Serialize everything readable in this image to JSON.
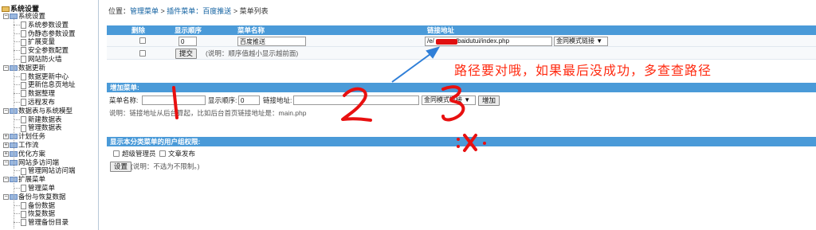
{
  "sidebar": {
    "root": "系统设置",
    "items": [
      {
        "label": "系统设置",
        "kind": "group"
      },
      {
        "label": "系统参数设置",
        "kind": "leaf"
      },
      {
        "label": "伪静态参数设置",
        "kind": "leaf"
      },
      {
        "label": "扩展变量",
        "kind": "leaf"
      },
      {
        "label": "安全参数配置",
        "kind": "leaf"
      },
      {
        "label": "网站防火墙",
        "kind": "leaf"
      },
      {
        "label": "数据更新",
        "kind": "group"
      },
      {
        "label": "数据更新中心",
        "kind": "leaf"
      },
      {
        "label": "更新信息页地址",
        "kind": "leaf"
      },
      {
        "label": "数据整理",
        "kind": "leaf"
      },
      {
        "label": "远程发布",
        "kind": "leaf"
      },
      {
        "label": "数据表与系统模型",
        "kind": "group"
      },
      {
        "label": "新建数据表",
        "kind": "leaf"
      },
      {
        "label": "管理数据表",
        "kind": "leaf"
      },
      {
        "label": "计划任务",
        "kind": "group-collapsed"
      },
      {
        "label": "工作流",
        "kind": "group-collapsed"
      },
      {
        "label": "优化方案",
        "kind": "group-collapsed"
      },
      {
        "label": "网站多访问端",
        "kind": "group"
      },
      {
        "label": "管理网站访问端",
        "kind": "leaf"
      },
      {
        "label": "扩展菜单",
        "kind": "group"
      },
      {
        "label": "管理菜单",
        "kind": "leaf"
      },
      {
        "label": "备份与恢复数据",
        "kind": "group"
      },
      {
        "label": "备份数据",
        "kind": "leaf"
      },
      {
        "label": "恢复数据",
        "kind": "leaf"
      },
      {
        "label": "管理备份目录",
        "kind": "leaf"
      }
    ]
  },
  "breadcrumb": {
    "prefix": "位置：",
    "items": [
      "管理菜单",
      "插件菜单：百度推送",
      "菜单列表"
    ],
    "sep": " > "
  },
  "menu_list": {
    "headers": [
      "删除",
      "显示顺序",
      "菜单名称",
      "链接地址"
    ],
    "row": {
      "order": "0",
      "name": "百度推送",
      "url_visible_start": "/e/",
      "url_visible_end": "/baidutui/index.php",
      "mode": "金同模式链接"
    },
    "new_order": "0",
    "submit_label": "提交",
    "note": "(说明：顺序值越小显示越前面)"
  },
  "add_menu": {
    "title": "增加菜单:",
    "name_label": "菜单名称:",
    "order_label": "显示顺序:",
    "order_value": "0",
    "url_label": "链接地址:",
    "mode": "金同模式链接",
    "add_label": "增加",
    "note": "说明：链接地址从后台算起，比如后台首页链接地址是：main.php"
  },
  "permissions": {
    "title": "显示本分类菜单的用户组权限:",
    "options": [
      "超级管理员",
      "文章发布"
    ],
    "set_label": "设置",
    "note": "(说明：不选为不限制。)"
  },
  "annotation": {
    "text": "路径要对哦，如果最后没成功，多查查路径",
    "color": "#ff2a10"
  },
  "colors": {
    "header_bar": "#4a9ad8",
    "link": "#1060a0"
  }
}
